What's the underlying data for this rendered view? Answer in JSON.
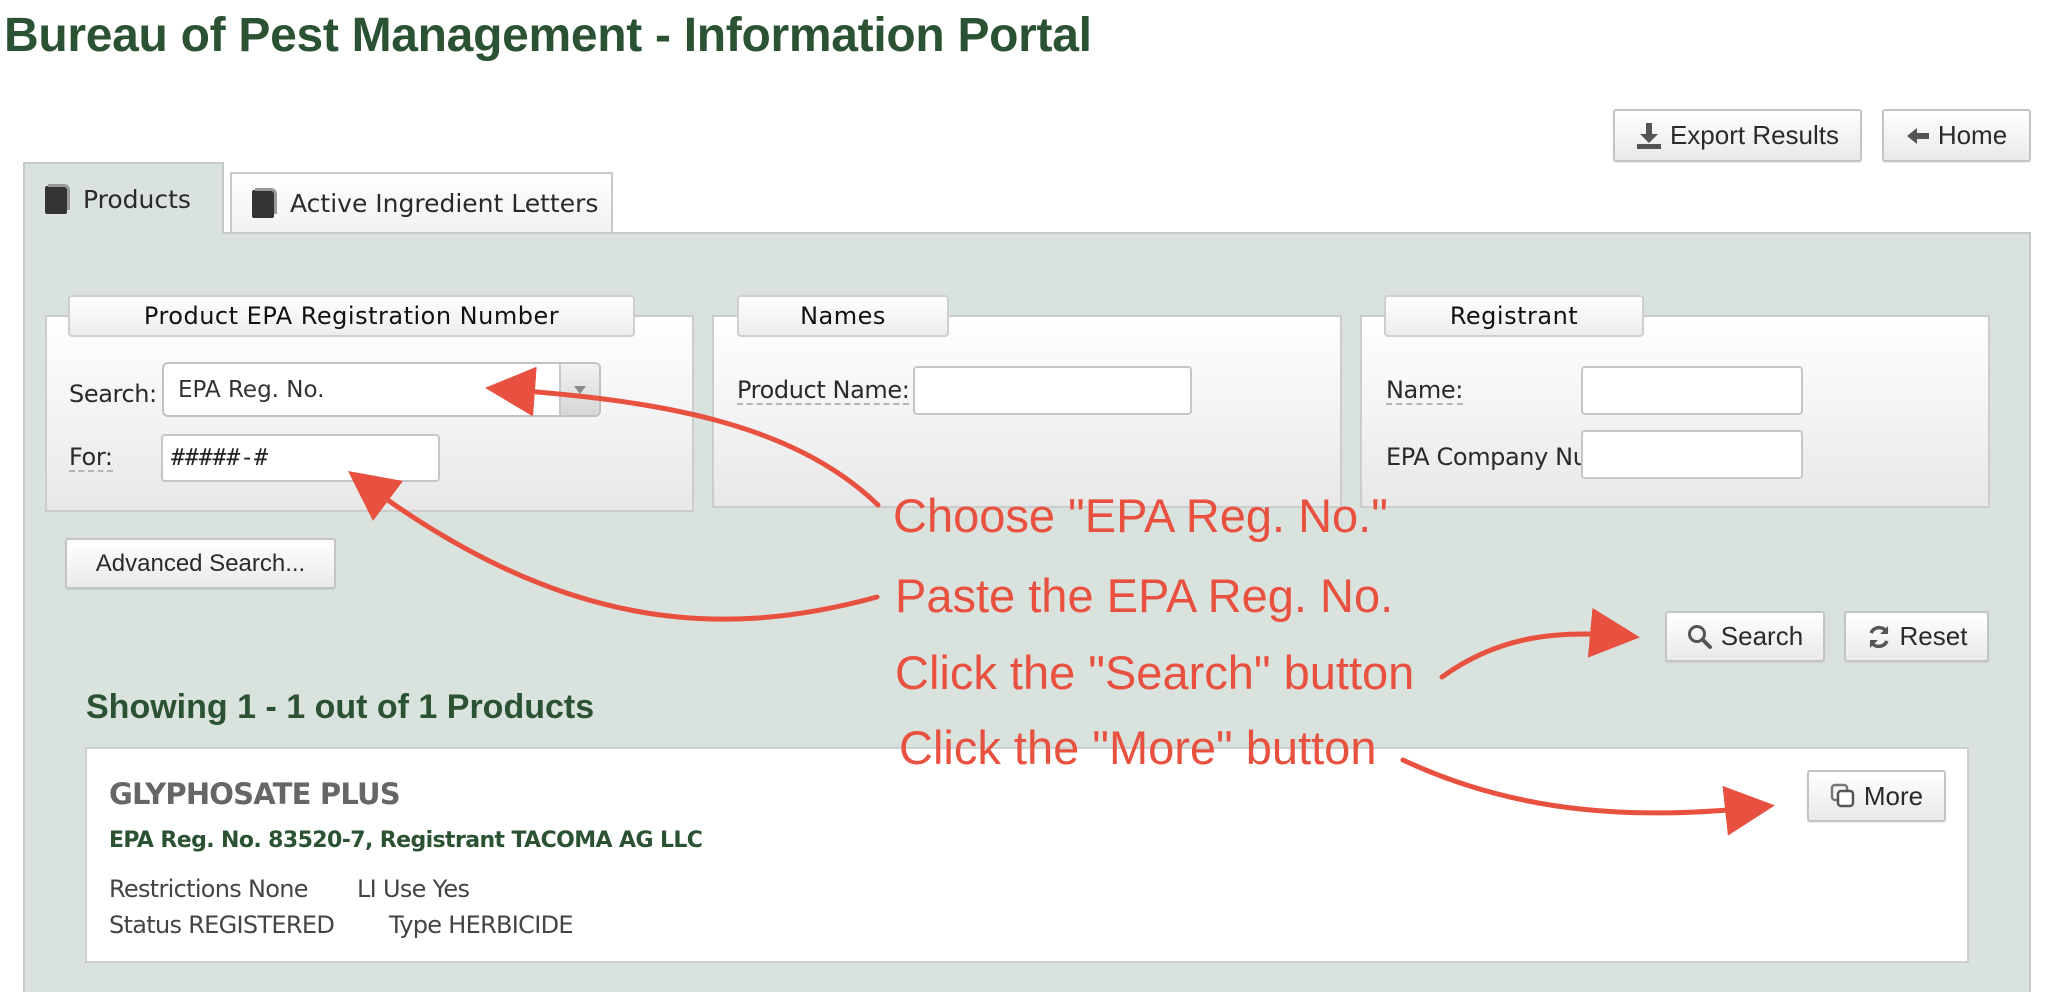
{
  "header": {
    "title": "Bureau of Pest Management - Information Portal"
  },
  "toolbar": {
    "export_label": "Export Results",
    "export_icon": "download-icon",
    "home_label": "Home",
    "home_icon": "arrow-left-icon"
  },
  "tabs": [
    {
      "label": "Products",
      "icon": "book-icon",
      "active": true
    },
    {
      "label": "Active Ingredient Letters",
      "icon": "book-icon",
      "active": false
    }
  ],
  "registration": {
    "legend": "Product EPA Registration Number",
    "search_label": "Search:",
    "search_selected": "EPA Reg. No.",
    "for_label": "For:",
    "for_value": "#####-#"
  },
  "names": {
    "legend": "Names",
    "product_name_label": "Product Name:",
    "product_name_value": ""
  },
  "registrant": {
    "legend": "Registrant",
    "name_label": "Name:",
    "name_value": "",
    "company_number_label": "EPA Company Number:",
    "company_number_value": ""
  },
  "actions": {
    "advanced_search_label": "Advanced Search...",
    "search_label": "Search",
    "search_icon": "magnifier-icon",
    "reset_label": "Reset",
    "reset_icon": "refresh-icon"
  },
  "results": {
    "heading": "Showing 1 - 1 out of 1 Products",
    "items": [
      {
        "name": "GLYPHOSATE PLUS",
        "subtitle": "EPA Reg. No. 83520-7, Registrant TACOMA AG LLC",
        "restrictions": "Restrictions None",
        "li_use": "LI Use Yes",
        "status": "Status REGISTERED",
        "type": "Type HERBICIDE",
        "more_label": "More",
        "more_icon": "copy-icon"
      }
    ]
  },
  "annotations": {
    "color": "#e8503f",
    "steps": [
      "Choose \"EPA Reg. No.\"",
      "Paste the EPA Reg. No.",
      "Click the \"Search\" button",
      "Click the \"More\" button"
    ]
  }
}
